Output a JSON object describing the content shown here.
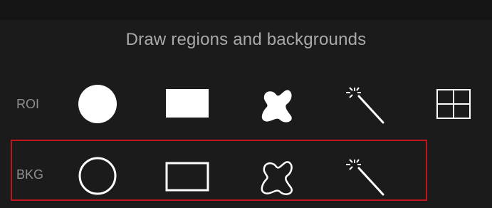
{
  "panel": {
    "title": "Draw regions and backgrounds"
  },
  "rows": {
    "roi": {
      "label": "ROI",
      "tools": [
        {
          "name": "circle",
          "icon": "filled-circle-icon"
        },
        {
          "name": "rectangle",
          "icon": "filled-rectangle-icon"
        },
        {
          "name": "freehand",
          "icon": "filled-freehand-shape-icon"
        },
        {
          "name": "magic-wand",
          "icon": "magic-wand-icon"
        },
        {
          "name": "grid",
          "icon": "grid-icon"
        }
      ]
    },
    "bkg": {
      "label": "BKG",
      "highlighted": true,
      "highlight_color": "#c0161b",
      "tools": [
        {
          "name": "circle",
          "icon": "outline-circle-icon"
        },
        {
          "name": "rectangle",
          "icon": "outline-rectangle-icon"
        },
        {
          "name": "freehand",
          "icon": "outline-freehand-shape-icon"
        },
        {
          "name": "magic-wand",
          "icon": "magic-wand-icon"
        }
      ]
    }
  },
  "colors": {
    "background": "#1b1b1b",
    "title_text": "#a9a9a9",
    "label_text": "#8f8f8f",
    "icon": "#ffffff",
    "highlight": "#c0161b"
  }
}
